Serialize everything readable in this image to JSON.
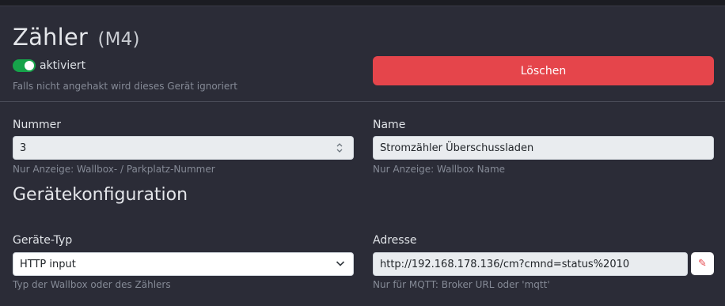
{
  "header": {
    "title": "Zähler",
    "subtitle": "(M4)",
    "switch_label": "aktiviert",
    "switch_on": true,
    "switch_help": "Falls nicht angehakt wird dieses Gerät ignoriert",
    "delete_label": "Löschen"
  },
  "fields": {
    "nummer": {
      "label": "Nummer",
      "value": "3",
      "help": "Nur Anzeige: Wallbox- / Parkplatz-Nummer"
    },
    "name": {
      "label": "Name",
      "value": "Stromzähler Überschussladen",
      "help": "Nur Anzeige: Wallbox Name"
    }
  },
  "section": {
    "title": "Gerätekonfiguration"
  },
  "config": {
    "typ": {
      "label": "Geräte-Typ",
      "value": "HTTP input",
      "help": "Typ der Wallbox oder des Zählers"
    },
    "adresse": {
      "label": "Adresse",
      "value": "http://192.168.178.136/cm?cmnd=status%2010",
      "help": "Nur für MQTT: Broker URL oder 'mqtt'"
    }
  },
  "colors": {
    "accent_green": "#16a34a",
    "danger": "#e5454b",
    "card_bg": "#2b2c37",
    "page_bg": "#1b1c22"
  },
  "icons": {
    "stepper": "stepper-icon",
    "select": "chevron-down-icon",
    "edit": "pencil-icon"
  }
}
